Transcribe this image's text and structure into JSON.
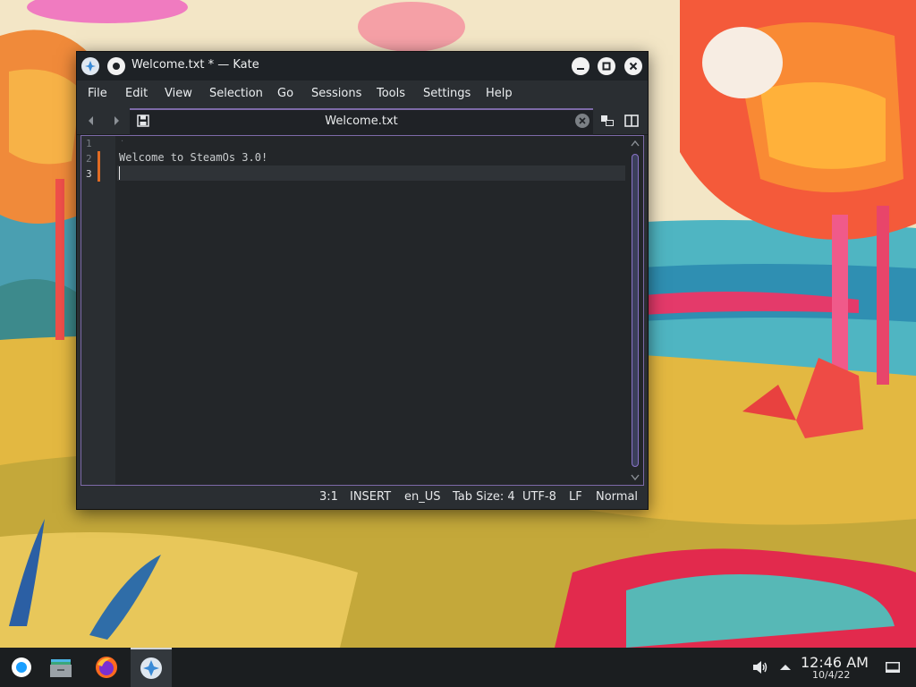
{
  "window": {
    "title": "Welcome.txt * — Kate",
    "app_icon": "kate-bird-icon",
    "buttons": {
      "minimize": "minimize-icon",
      "maximize": "maximize-icon",
      "close": "close-icon"
    }
  },
  "menubar": {
    "items": [
      "File",
      "Edit",
      "View",
      "Selection",
      "Go",
      "Sessions",
      "Tools",
      "Settings",
      "Help"
    ]
  },
  "tabbar": {
    "back_icon": "chevron-left-icon",
    "forward_icon": "chevron-right-icon",
    "tab": {
      "label": "Welcome.txt",
      "save_icon": "floppy-save-icon",
      "close_icon": "close-circle-icon"
    },
    "split_icons": [
      "quick-open-icon",
      "split-view-icon"
    ]
  },
  "editor": {
    "line_numbers": [
      "1",
      "2",
      "3"
    ],
    "lines": [
      "",
      "Welcome to SteamOs 3.0!",
      ""
    ],
    "modified_lines": [
      2,
      3
    ],
    "current_line": 3
  },
  "statusbar": {
    "cursor": "3:1",
    "mode": "INSERT",
    "dictionary": "en_US",
    "tab_size": "Tab Size: 4",
    "encoding": "UTF-8",
    "eol": "LF",
    "highlighting": "Normal"
  },
  "taskbar": {
    "apps": [
      "steam-deck-icon",
      "files-icon",
      "firefox-icon",
      "kate-icon"
    ],
    "tray_icons": [
      "volume-icon",
      "tray-expand-icon"
    ],
    "time": "12:46 AM",
    "date": "10/4/22",
    "show_desktop_icon": "show-desktop-icon"
  },
  "colors": {
    "accent": "#7d6aa8",
    "modified_marker": "#e06b24",
    "window_bg": "#2a2e32",
    "editor_bg": "#232629"
  }
}
